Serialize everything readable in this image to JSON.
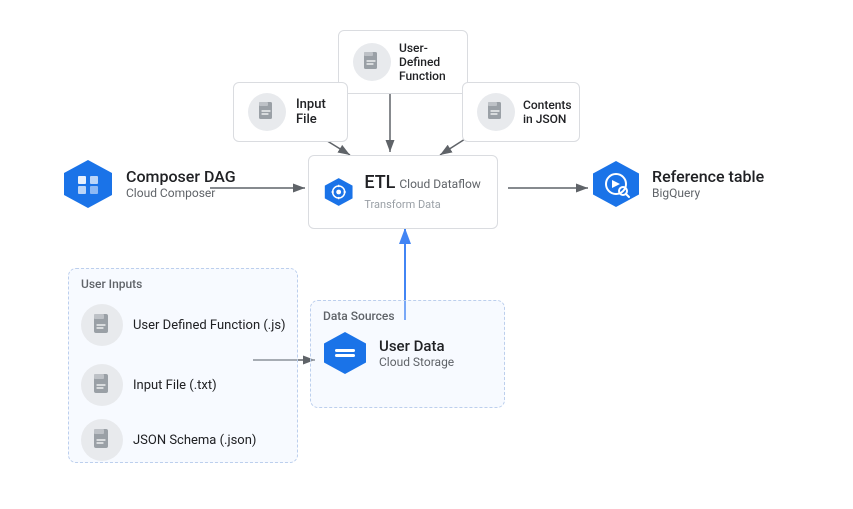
{
  "nodes": {
    "composer": {
      "title": "Composer DAG",
      "subtitle": "Cloud Composer"
    },
    "etl": {
      "title": "ETL",
      "sub1": "Cloud Dataflow",
      "sub2": "Transform Data"
    },
    "reference": {
      "title": "Reference table",
      "subtitle": "BigQuery"
    },
    "inputFile": {
      "title": "Input File"
    },
    "userDefinedFunction": {
      "title": "User-Defined",
      "title2": "Function"
    },
    "contentsJSON": {
      "title": "Contents",
      "title2": "in JSON"
    },
    "userInputs": {
      "groupLabel": "User Inputs",
      "items": [
        {
          "label": "User Defined Function (.js)"
        },
        {
          "label": "Input File (.txt)"
        },
        {
          "label": "JSON Schema (.json)"
        }
      ]
    },
    "dataSources": {
      "groupLabel": "Data Sources",
      "title": "User Data",
      "subtitle": "Cloud Storage"
    }
  }
}
